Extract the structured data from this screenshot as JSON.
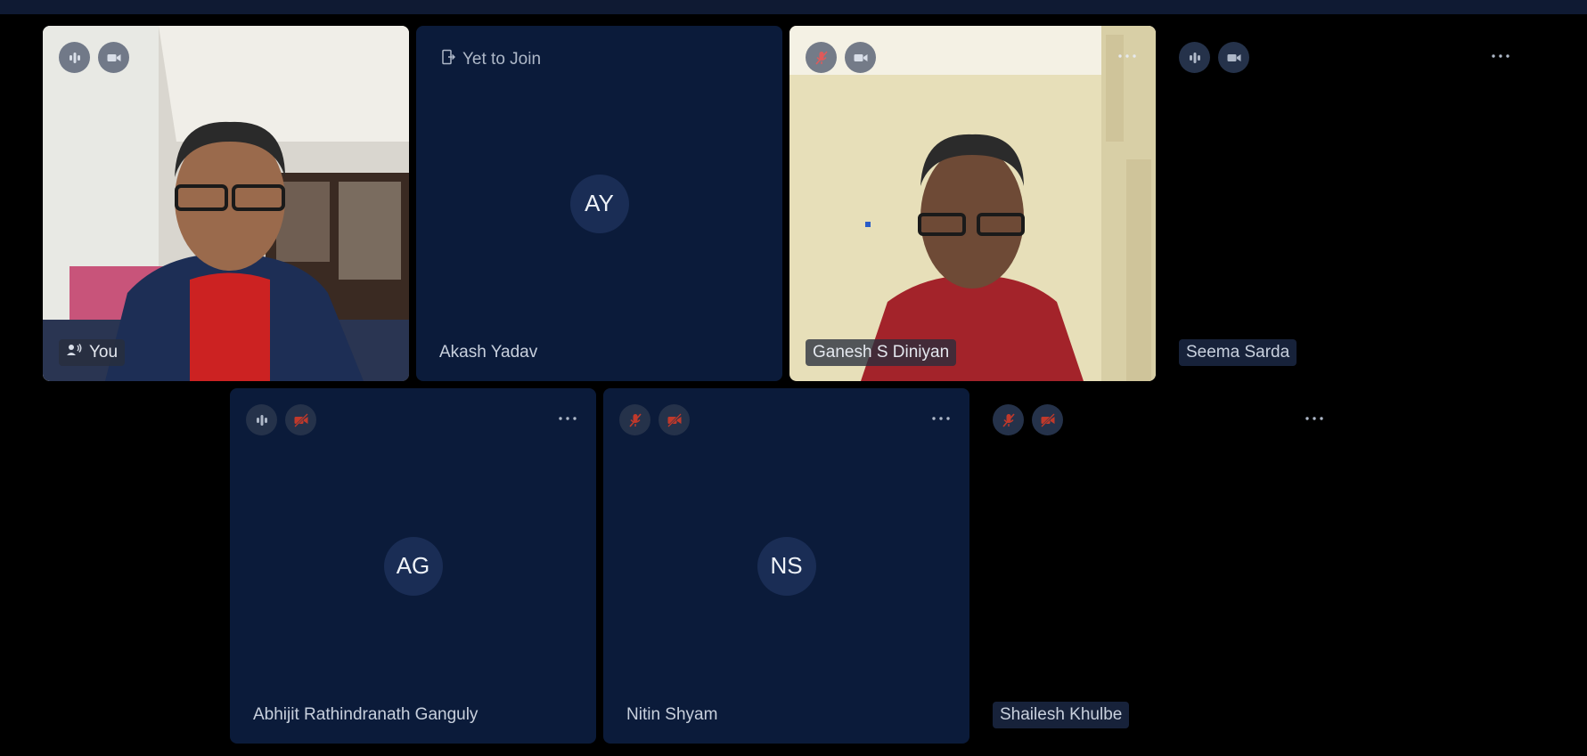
{
  "participants": {
    "you": {
      "name": "You",
      "mic": "on",
      "camera": "on"
    },
    "akash": {
      "name": "Akash Yadav",
      "initials": "AY",
      "status": "Yet to Join"
    },
    "ganesh": {
      "name": "Ganesh S Diniyan",
      "mic": "muted",
      "camera": "on"
    },
    "seema": {
      "name": "Seema Sarda",
      "mic": "on",
      "camera": "on"
    },
    "abhijit": {
      "name": "Abhijit Rathindranath Ganguly",
      "initials": "AG",
      "mic": "on",
      "camera": "off"
    },
    "nitin": {
      "name": "Nitin Shyam",
      "initials": "NS",
      "mic": "muted",
      "camera": "off"
    },
    "shailesh": {
      "name": "Shailesh Khulbe",
      "mic": "muted",
      "camera": "off"
    }
  },
  "icons": {
    "audio_level": "audio-level-icon",
    "camera_on": "camera-icon",
    "mic_off": "mic-off-icon",
    "camera_off": "camera-off-icon",
    "more": "more-options-icon",
    "speaking": "speaking-icon",
    "yet_to_join": "door-exit-icon"
  },
  "colors": {
    "tile_navy": "#0b1b3a",
    "background": "#000000",
    "avatar_bg": "#1a2d55",
    "mute_red": "#c0392b"
  }
}
